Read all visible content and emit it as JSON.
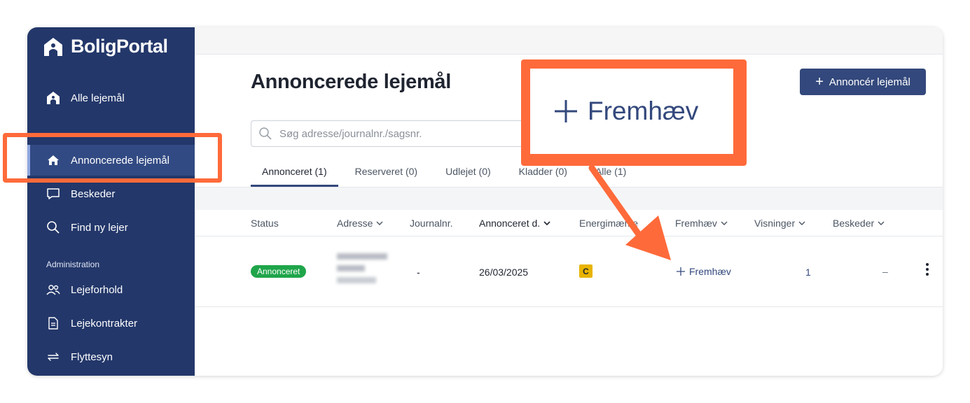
{
  "app": {
    "logo_text": "BoligPortal"
  },
  "sidebar": {
    "items": [
      {
        "label": "Alle lejemål",
        "icon": "house-icon"
      },
      {
        "label": "Annoncerede lejemål",
        "icon": "home-icon",
        "active": true
      },
      {
        "label": "Beskeder",
        "icon": "chat-icon"
      },
      {
        "label": "Find ny lejer",
        "icon": "search-icon"
      }
    ],
    "admin_label": "Administration",
    "admin_items": [
      {
        "label": "Lejeforhold",
        "icon": "users-icon"
      },
      {
        "label": "Lejekontrakter",
        "icon": "document-icon"
      },
      {
        "label": "Flyttesyn",
        "icon": "swap-icon"
      }
    ]
  },
  "main": {
    "title": "Annoncerede lejemål",
    "create_button": "Annoncér lejemål",
    "search_placeholder": "Søg adresse/journalnr./sagsnr.",
    "tabs": [
      {
        "label": "Annonceret (1)",
        "active": true
      },
      {
        "label": "Reserveret (0)"
      },
      {
        "label": "Udlejet (0)"
      },
      {
        "label": "Kladder (0)"
      },
      {
        "label": "Alle (1)"
      }
    ],
    "columns": [
      "Status",
      "Adresse",
      "Journalnr.",
      "Annonceret d.",
      "Energimærke",
      "Fremhæv",
      "Visninger",
      "Beskeder"
    ],
    "rows": [
      {
        "status": "Annonceret",
        "journal": "-",
        "date": "26/03/2025",
        "energy": "C",
        "feature": "Fremhæv",
        "views": "1",
        "messages": "–"
      }
    ]
  },
  "callout": {
    "label": "Fremhæv"
  },
  "colors": {
    "sidebar": "#23376a",
    "accent": "#33487c",
    "highlight": "#ff6a3a",
    "status_green": "#1fa54a",
    "energy_c": "#e8b400"
  }
}
